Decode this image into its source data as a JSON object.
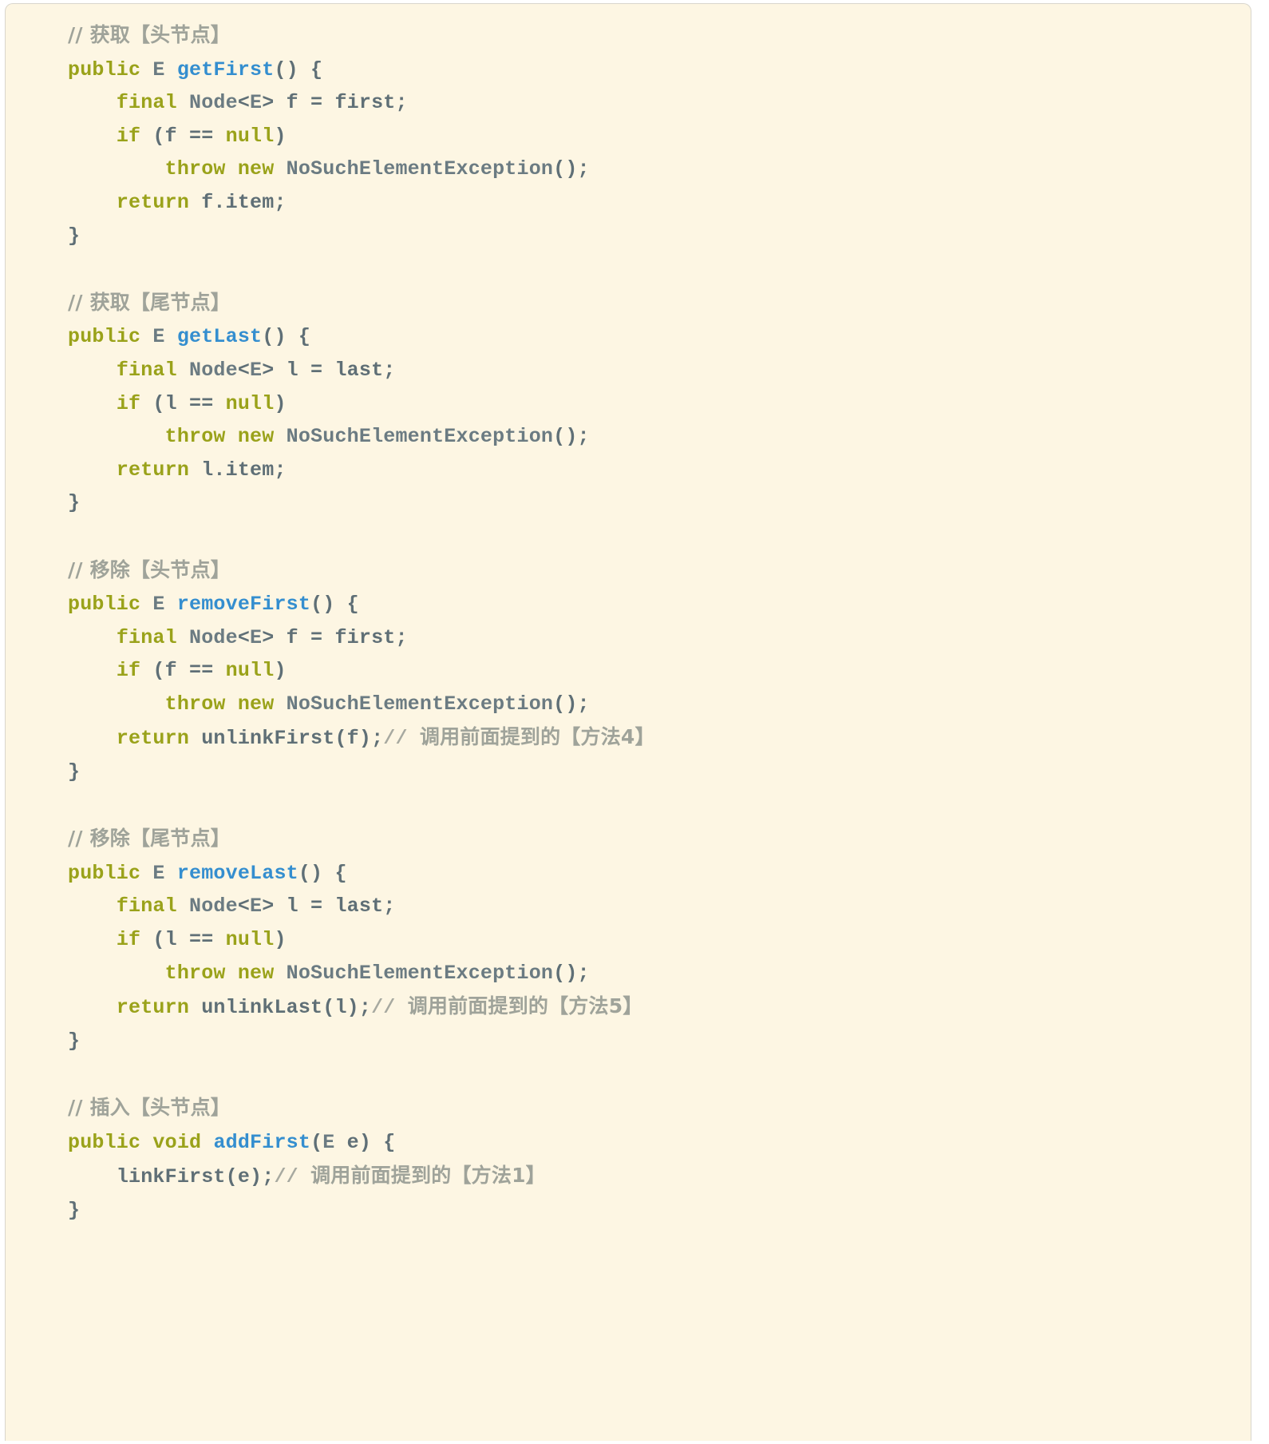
{
  "theme": {
    "background": "#fdf6e3",
    "border": "#d9d6cc",
    "keyword_color": "#9aa21a",
    "type_color": "#6b7b82",
    "function_color": "#348ecf",
    "plain_color": "#5f6f76",
    "comment_color": "#a7a9a0"
  },
  "code": {
    "language": "java",
    "lines": [
      {
        "id": "l1",
        "type": "comment",
        "indent": 0,
        "text": "// 获取【头节点】"
      },
      {
        "id": "l2",
        "type": "code",
        "indent": 0,
        "tokens": [
          {
            "t": "public",
            "c": "kw"
          },
          {
            "t": " ",
            "c": "pln"
          },
          {
            "t": "E",
            "c": "typ"
          },
          {
            "t": " ",
            "c": "pln"
          },
          {
            "t": "getFirst",
            "c": "fn"
          },
          {
            "t": "() {",
            "c": "pln"
          }
        ]
      },
      {
        "id": "l3",
        "type": "code",
        "indent": 1,
        "tokens": [
          {
            "t": "final",
            "c": "kw"
          },
          {
            "t": " ",
            "c": "pln"
          },
          {
            "t": "Node",
            "c": "typ"
          },
          {
            "t": "<",
            "c": "pln"
          },
          {
            "t": "E",
            "c": "typ"
          },
          {
            "t": "> f = first;",
            "c": "pln"
          }
        ]
      },
      {
        "id": "l4",
        "type": "code",
        "indent": 1,
        "tokens": [
          {
            "t": "if",
            "c": "kw"
          },
          {
            "t": " (f == ",
            "c": "pln"
          },
          {
            "t": "null",
            "c": "kw"
          },
          {
            "t": ")",
            "c": "pln"
          }
        ]
      },
      {
        "id": "l5",
        "type": "code",
        "indent": 2,
        "tokens": [
          {
            "t": "throw",
            "c": "kw"
          },
          {
            "t": " ",
            "c": "pln"
          },
          {
            "t": "new",
            "c": "kw"
          },
          {
            "t": " ",
            "c": "pln"
          },
          {
            "t": "NoSuchElementException",
            "c": "typ"
          },
          {
            "t": "();",
            "c": "pln"
          }
        ]
      },
      {
        "id": "l6",
        "type": "code",
        "indent": 1,
        "tokens": [
          {
            "t": "return",
            "c": "kw"
          },
          {
            "t": " f.item;",
            "c": "pln"
          }
        ]
      },
      {
        "id": "l7",
        "type": "code",
        "indent": 0,
        "tokens": [
          {
            "t": "}",
            "c": "pln"
          }
        ]
      },
      {
        "id": "l8",
        "type": "blank",
        "indent": 0,
        "text": ""
      },
      {
        "id": "l9",
        "type": "comment",
        "indent": 0,
        "text": "// 获取【尾节点】"
      },
      {
        "id": "l10",
        "type": "code",
        "indent": 0,
        "tokens": [
          {
            "t": "public",
            "c": "kw"
          },
          {
            "t": " ",
            "c": "pln"
          },
          {
            "t": "E",
            "c": "typ"
          },
          {
            "t": " ",
            "c": "pln"
          },
          {
            "t": "getLast",
            "c": "fn"
          },
          {
            "t": "() {",
            "c": "pln"
          }
        ]
      },
      {
        "id": "l11",
        "type": "code",
        "indent": 1,
        "tokens": [
          {
            "t": "final",
            "c": "kw"
          },
          {
            "t": " ",
            "c": "pln"
          },
          {
            "t": "Node",
            "c": "typ"
          },
          {
            "t": "<",
            "c": "pln"
          },
          {
            "t": "E",
            "c": "typ"
          },
          {
            "t": "> l = last;",
            "c": "pln"
          }
        ]
      },
      {
        "id": "l12",
        "type": "code",
        "indent": 1,
        "tokens": [
          {
            "t": "if",
            "c": "kw"
          },
          {
            "t": " (l == ",
            "c": "pln"
          },
          {
            "t": "null",
            "c": "kw"
          },
          {
            "t": ")",
            "c": "pln"
          }
        ]
      },
      {
        "id": "l13",
        "type": "code",
        "indent": 2,
        "tokens": [
          {
            "t": "throw",
            "c": "kw"
          },
          {
            "t": " ",
            "c": "pln"
          },
          {
            "t": "new",
            "c": "kw"
          },
          {
            "t": " ",
            "c": "pln"
          },
          {
            "t": "NoSuchElementException",
            "c": "typ"
          },
          {
            "t": "();",
            "c": "pln"
          }
        ]
      },
      {
        "id": "l14",
        "type": "code",
        "indent": 1,
        "tokens": [
          {
            "t": "return",
            "c": "kw"
          },
          {
            "t": " l.item;",
            "c": "pln"
          }
        ]
      },
      {
        "id": "l15",
        "type": "code",
        "indent": 0,
        "tokens": [
          {
            "t": "}",
            "c": "pln"
          }
        ]
      },
      {
        "id": "l16",
        "type": "blank",
        "indent": 0,
        "text": ""
      },
      {
        "id": "l17",
        "type": "comment",
        "indent": 0,
        "text": "// 移除【头节点】"
      },
      {
        "id": "l18",
        "type": "code",
        "indent": 0,
        "tokens": [
          {
            "t": "public",
            "c": "kw"
          },
          {
            "t": " ",
            "c": "pln"
          },
          {
            "t": "E",
            "c": "typ"
          },
          {
            "t": " ",
            "c": "pln"
          },
          {
            "t": "removeFirst",
            "c": "fn"
          },
          {
            "t": "() {",
            "c": "pln"
          }
        ]
      },
      {
        "id": "l19",
        "type": "code",
        "indent": 1,
        "tokens": [
          {
            "t": "final",
            "c": "kw"
          },
          {
            "t": " ",
            "c": "pln"
          },
          {
            "t": "Node",
            "c": "typ"
          },
          {
            "t": "<",
            "c": "pln"
          },
          {
            "t": "E",
            "c": "typ"
          },
          {
            "t": "> f = first;",
            "c": "pln"
          }
        ]
      },
      {
        "id": "l20",
        "type": "code",
        "indent": 1,
        "tokens": [
          {
            "t": "if",
            "c": "kw"
          },
          {
            "t": " (f == ",
            "c": "pln"
          },
          {
            "t": "null",
            "c": "kw"
          },
          {
            "t": ")",
            "c": "pln"
          }
        ]
      },
      {
        "id": "l21",
        "type": "code",
        "indent": 2,
        "tokens": [
          {
            "t": "throw",
            "c": "kw"
          },
          {
            "t": " ",
            "c": "pln"
          },
          {
            "t": "new",
            "c": "kw"
          },
          {
            "t": " ",
            "c": "pln"
          },
          {
            "t": "NoSuchElementException",
            "c": "typ"
          },
          {
            "t": "();",
            "c": "pln"
          }
        ]
      },
      {
        "id": "l22",
        "type": "code",
        "indent": 1,
        "tokens": [
          {
            "t": "return",
            "c": "kw"
          },
          {
            "t": " unlinkFirst(f);",
            "c": "pln"
          },
          {
            "t": "// ",
            "c": "cmt"
          },
          {
            "t": "调用前面提到的【方法4】",
            "c": "cmt-cn"
          }
        ]
      },
      {
        "id": "l23",
        "type": "code",
        "indent": 0,
        "tokens": [
          {
            "t": "}",
            "c": "pln"
          }
        ]
      },
      {
        "id": "l24",
        "type": "blank",
        "indent": 0,
        "text": ""
      },
      {
        "id": "l25",
        "type": "comment",
        "indent": 0,
        "text": "// 移除【尾节点】"
      },
      {
        "id": "l26",
        "type": "code",
        "indent": 0,
        "tokens": [
          {
            "t": "public",
            "c": "kw"
          },
          {
            "t": " ",
            "c": "pln"
          },
          {
            "t": "E",
            "c": "typ"
          },
          {
            "t": " ",
            "c": "pln"
          },
          {
            "t": "removeLast",
            "c": "fn"
          },
          {
            "t": "() {",
            "c": "pln"
          }
        ]
      },
      {
        "id": "l27",
        "type": "code",
        "indent": 1,
        "tokens": [
          {
            "t": "final",
            "c": "kw"
          },
          {
            "t": " ",
            "c": "pln"
          },
          {
            "t": "Node",
            "c": "typ"
          },
          {
            "t": "<",
            "c": "pln"
          },
          {
            "t": "E",
            "c": "typ"
          },
          {
            "t": "> l = last;",
            "c": "pln"
          }
        ]
      },
      {
        "id": "l28",
        "type": "code",
        "indent": 1,
        "tokens": [
          {
            "t": "if",
            "c": "kw"
          },
          {
            "t": " (l == ",
            "c": "pln"
          },
          {
            "t": "null",
            "c": "kw"
          },
          {
            "t": ")",
            "c": "pln"
          }
        ]
      },
      {
        "id": "l29",
        "type": "code",
        "indent": 2,
        "tokens": [
          {
            "t": "throw",
            "c": "kw"
          },
          {
            "t": " ",
            "c": "pln"
          },
          {
            "t": "new",
            "c": "kw"
          },
          {
            "t": " ",
            "c": "pln"
          },
          {
            "t": "NoSuchElementException",
            "c": "typ"
          },
          {
            "t": "();",
            "c": "pln"
          }
        ]
      },
      {
        "id": "l30",
        "type": "code",
        "indent": 1,
        "tokens": [
          {
            "t": "return",
            "c": "kw"
          },
          {
            "t": " unlinkLast(l);",
            "c": "pln"
          },
          {
            "t": "// ",
            "c": "cmt"
          },
          {
            "t": "调用前面提到的【方法5】",
            "c": "cmt-cn"
          }
        ]
      },
      {
        "id": "l31",
        "type": "code",
        "indent": 0,
        "tokens": [
          {
            "t": "}",
            "c": "pln"
          }
        ]
      },
      {
        "id": "l32",
        "type": "blank",
        "indent": 0,
        "text": ""
      },
      {
        "id": "l33",
        "type": "comment",
        "indent": 0,
        "text": "// 插入【头节点】"
      },
      {
        "id": "l34",
        "type": "code",
        "indent": 0,
        "tokens": [
          {
            "t": "public",
            "c": "kw"
          },
          {
            "t": " ",
            "c": "pln"
          },
          {
            "t": "void",
            "c": "kw"
          },
          {
            "t": " ",
            "c": "pln"
          },
          {
            "t": "addFirst",
            "c": "fn"
          },
          {
            "t": "(",
            "c": "pln"
          },
          {
            "t": "E",
            "c": "typ"
          },
          {
            "t": " e) {",
            "c": "pln"
          }
        ]
      },
      {
        "id": "l35",
        "type": "code",
        "indent": 1,
        "tokens": [
          {
            "t": "linkFirst(e);",
            "c": "pln"
          },
          {
            "t": "// ",
            "c": "cmt"
          },
          {
            "t": "调用前面提到的【方法1】",
            "c": "cmt-cn"
          }
        ]
      },
      {
        "id": "l36",
        "type": "code",
        "indent": 0,
        "tokens": [
          {
            "t": "}",
            "c": "pln"
          }
        ]
      }
    ]
  }
}
